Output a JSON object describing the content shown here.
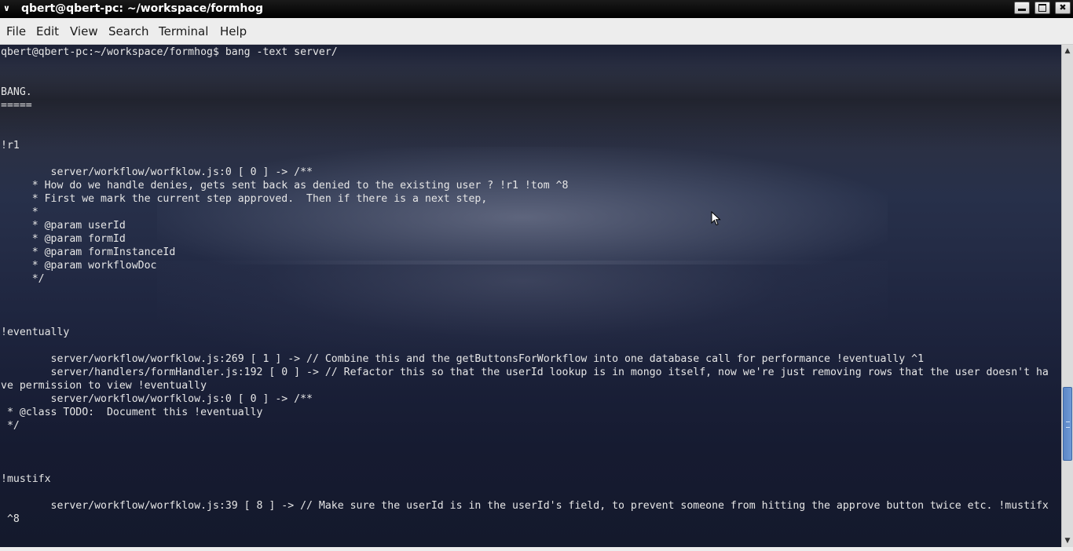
{
  "window": {
    "title": "qbert@qbert-pc: ~/workspace/formhog",
    "minimize_icon": "minimize-icon",
    "maximize_icon": "maximize-icon",
    "close_icon": "close-icon"
  },
  "menu": {
    "items": [
      "File",
      "Edit",
      "View",
      "Search",
      "Terminal",
      "Help"
    ]
  },
  "terminal": {
    "lines": [
      "qbert@qbert-pc:~/workspace/formhog$ bang -text server/",
      "",
      "",
      "BANG.",
      "=====",
      "",
      "",
      "!r1",
      "",
      "        server/workflow/worfklow.js:0 [ 0 ] -> /**",
      "     * How do we handle denies, gets sent back as denied to the existing user ? !r1 !tom ^8",
      "     * First we mark the current step approved.  Then if there is a next step,",
      "     *",
      "     * @param userId",
      "     * @param formId",
      "     * @param formInstanceId",
      "     * @param workflowDoc",
      "     */",
      "",
      "",
      "",
      "!eventually",
      "",
      "        server/workflow/worfklow.js:269 [ 1 ] -> // Combine this and the getButtonsForWorkflow into one database call for performance !eventually ^1",
      "        server/handlers/formHandler.js:192 [ 0 ] -> // Refactor this so that the userId lookup is in mongo itself, now we're just removing rows that the user doesn't ha",
      "ve permission to view !eventually",
      "        server/workflow/worfklow.js:0 [ 0 ] -> /**",
      " * @class TODO:  Document this !eventually",
      " */",
      "",
      "",
      "",
      "!mustifx",
      "",
      "        server/workflow/worfklow.js:39 [ 8 ] -> // Make sure the userId is in the userId's field, to prevent someone from hitting the approve button twice etc. !mustifx",
      " ^8",
      ""
    ]
  },
  "scrollbar": {
    "up_icon": "scroll-up-arrow-icon",
    "down_icon": "scroll-down-arrow-icon",
    "position_fraction": 0.72
  }
}
